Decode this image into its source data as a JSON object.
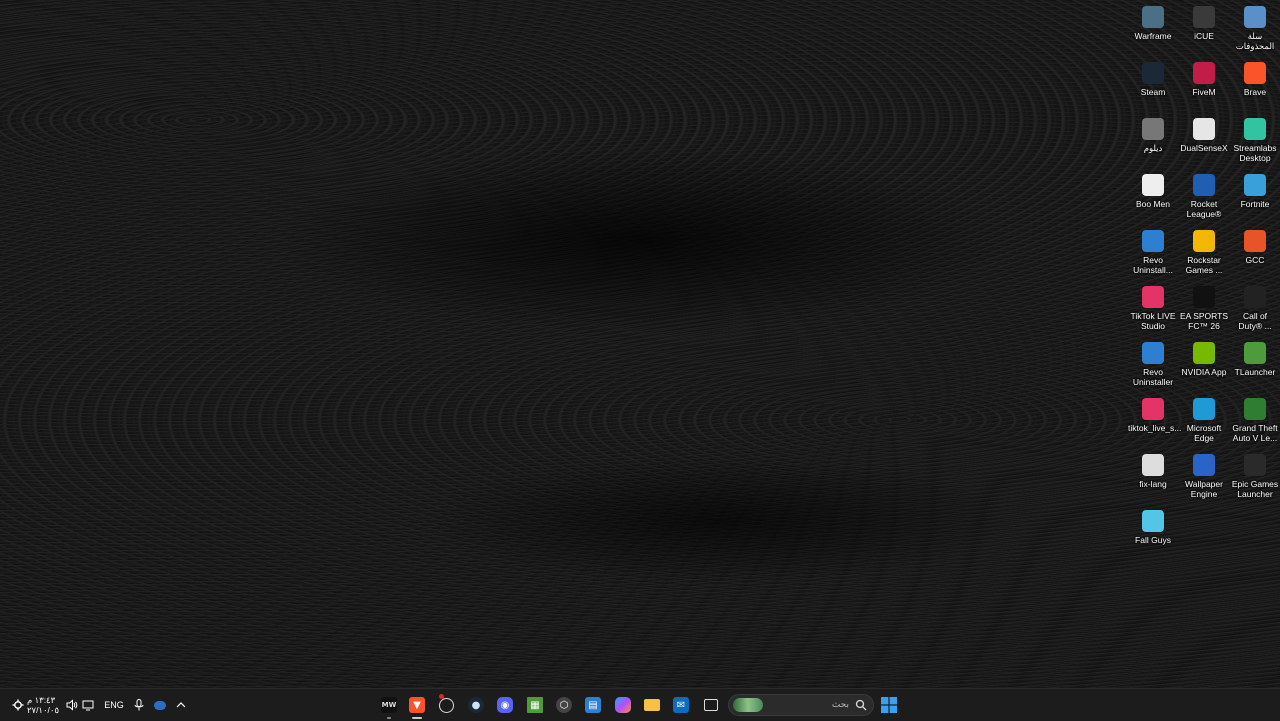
{
  "desktop_icons": [
    {
      "label": "Warframe",
      "icon": "warframe-icon",
      "color": "#4b6f86"
    },
    {
      "label": "iCUE",
      "icon": "icue-icon",
      "color": "#3a3a3a"
    },
    {
      "label": "سلة المحذوفات",
      "icon": "recycle-bin-icon",
      "color": "#5b8fc7"
    },
    {
      "label": "Steam",
      "icon": "steam-icon",
      "color": "#1b2838"
    },
    {
      "label": "FiveM",
      "icon": "fivem-icon",
      "color": "#c21d48"
    },
    {
      "label": "Brave",
      "icon": "brave-icon",
      "color": "#fb542b"
    },
    {
      "label": "ديلوم",
      "icon": "file-icon",
      "color": "#777777"
    },
    {
      "label": "DualSenseX",
      "icon": "dualsensex-icon",
      "color": "#e6e6e6"
    },
    {
      "label": "Streamlabs Desktop",
      "icon": "streamlabs-icon",
      "color": "#31c3a2"
    },
    {
      "label": "Boo Men",
      "icon": "ghost-icon",
      "color": "#eeeeee"
    },
    {
      "label": "Rocket League®",
      "icon": "rocket-league-icon",
      "color": "#1e5fb4"
    },
    {
      "label": "Fortnite",
      "icon": "fortnite-icon",
      "color": "#3aa0d8"
    },
    {
      "label": "Revo Uninstall...",
      "icon": "revo-uninstaller-icon",
      "color": "#2f7fd0"
    },
    {
      "label": "Rockstar Games ...",
      "icon": "rockstar-icon",
      "color": "#f2b705"
    },
    {
      "label": "GCC",
      "icon": "gcc-icon",
      "color": "#e8542a"
    },
    {
      "label": "TikTok LIVE Studio",
      "icon": "tiktok-live-icon",
      "color": "#e43367"
    },
    {
      "label": "EA SPORTS FC™ 26",
      "icon": "ea-fc-icon",
      "color": "#111111"
    },
    {
      "label": "Call of Duty® ...",
      "icon": "call-of-duty-icon",
      "color": "#222222"
    },
    {
      "label": "Revo Uninstaller",
      "icon": "revo-uninstaller-icon",
      "color": "#2f7fd0"
    },
    {
      "label": "NVIDIA App",
      "icon": "nvidia-icon",
      "color": "#76b900"
    },
    {
      "label": "TLauncher",
      "icon": "tlauncher-icon",
      "color": "#4f9a3a"
    },
    {
      "label": "tiktok_live_s...",
      "icon": "tiktok-live-icon",
      "color": "#e43367"
    },
    {
      "label": "Microsoft Edge",
      "icon": "edge-icon",
      "color": "#1e9ad6"
    },
    {
      "label": "Grand Theft Auto V Le...",
      "icon": "gta-v-icon",
      "color": "#2e7d32"
    },
    {
      "label": "fix-lang",
      "icon": "file-icon",
      "color": "#dddddd"
    },
    {
      "label": "Wallpaper Engine",
      "icon": "wallpaper-engine-icon",
      "color": "#2a64c6"
    },
    {
      "label": "Epic Games Launcher",
      "icon": "epic-games-icon",
      "color": "#2a2a2a"
    },
    {
      "label": "Fall Guys",
      "icon": "fall-guys-icon",
      "color": "#53c6e8"
    }
  ],
  "taskbar": {
    "clock_time": "١٣:٤٣ م",
    "clock_date": "٢٧/١٠/٠٥",
    "language": "ENG",
    "search_placeholder": "بحث",
    "start_color": "#3aa0f0"
  }
}
